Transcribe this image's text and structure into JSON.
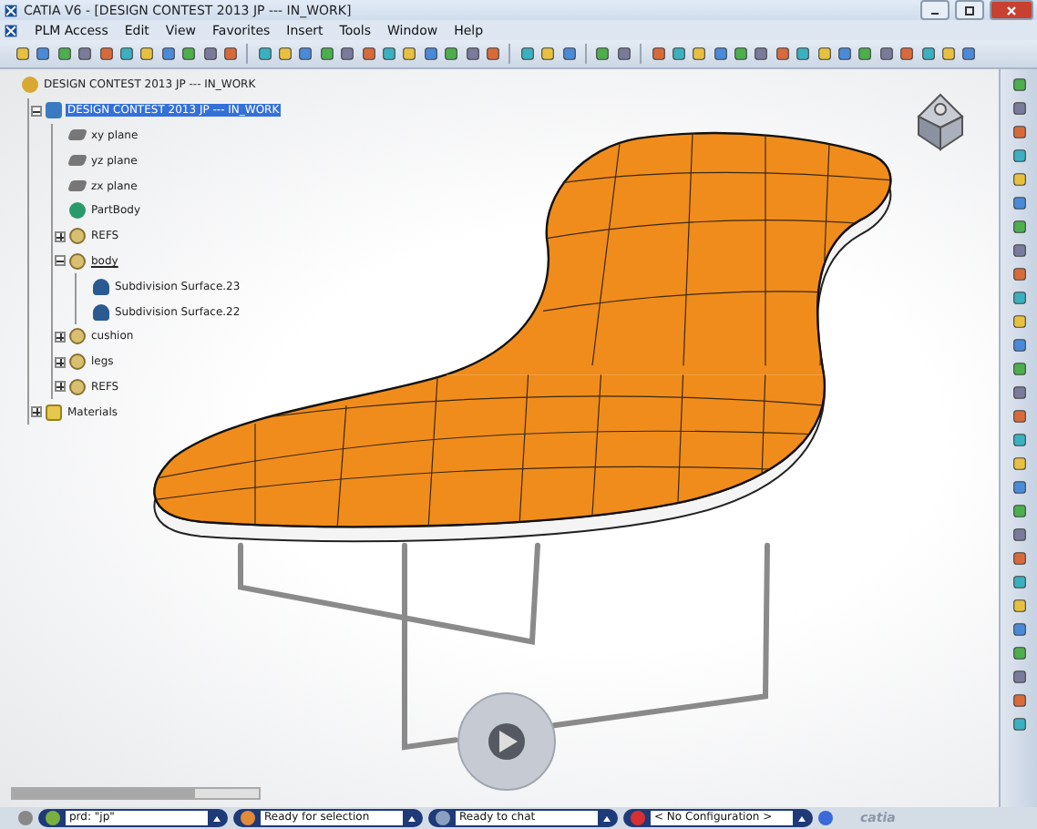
{
  "window": {
    "title": "CATIA V6 - [DESIGN CONTEST 2013 JP --- IN_WORK]"
  },
  "menu": [
    "PLM Access",
    "Edit",
    "View",
    "Favorites",
    "Insert",
    "Tools",
    "Window",
    "Help"
  ],
  "tree": [
    {
      "label": "DESIGN CONTEST 2013 JP --- IN_WORK",
      "kind": "product",
      "selected": false,
      "children": [
        {
          "label": "DESIGN CONTEST 2013 JP --- IN_WORK",
          "kind": "part",
          "selected": true,
          "expanded": true,
          "children": [
            {
              "label": "xy plane",
              "kind": "plane",
              "selected": false
            },
            {
              "label": "yz plane",
              "kind": "plane",
              "selected": false
            },
            {
              "label": "zx plane",
              "kind": "plane",
              "selected": false
            },
            {
              "label": "PartBody",
              "kind": "body",
              "selected": false
            },
            {
              "label": "REFS",
              "kind": "geoset",
              "selected": false,
              "expanded": false
            },
            {
              "label": "body",
              "kind": "geoset",
              "selected": false,
              "expanded": true,
              "children": [
                {
                  "label": "Subdivision Surface.23",
                  "kind": "surface",
                  "selected": false
                },
                {
                  "label": "Subdivision Surface.22",
                  "kind": "surface",
                  "selected": false
                }
              ]
            },
            {
              "label": "cushion",
              "kind": "geoset",
              "selected": false,
              "expanded": false
            },
            {
              "label": "legs",
              "kind": "geoset",
              "selected": false,
              "expanded": false
            },
            {
              "label": "REFS",
              "kind": "geoset",
              "selected": false,
              "expanded": false
            }
          ]
        },
        {
          "label": "Materials",
          "kind": "folder",
          "selected": false,
          "expanded": false
        }
      ]
    }
  ],
  "status_bar": [
    {
      "text": "prd: \"jp\""
    },
    {
      "text": "Ready for selection"
    },
    {
      "text": "Ready to chat"
    },
    {
      "text": "< No Configuration >"
    }
  ],
  "logo": "catia"
}
